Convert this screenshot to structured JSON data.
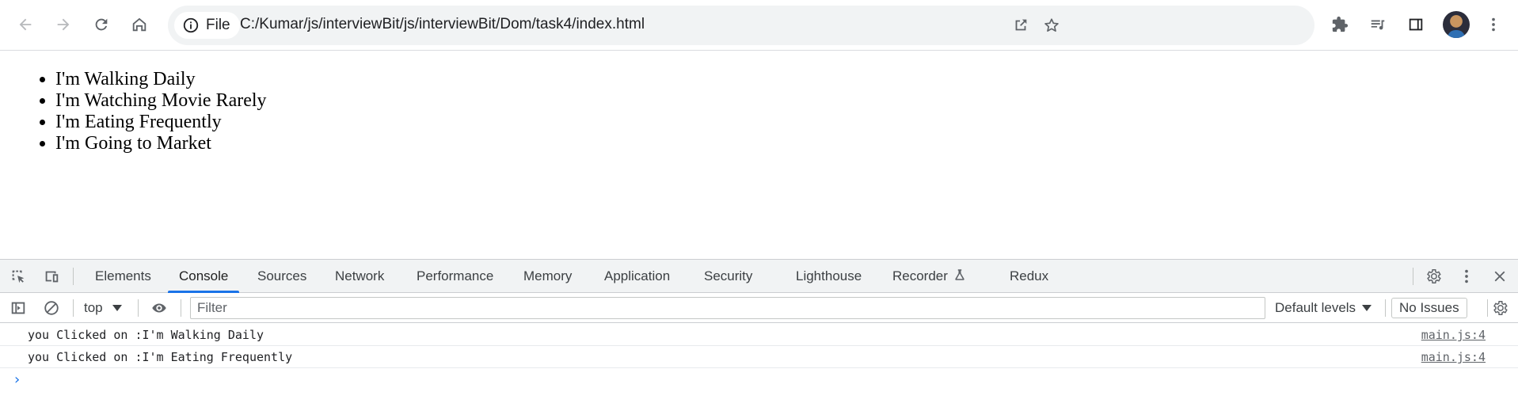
{
  "browser": {
    "site_info_label": "File",
    "url": "C:/Kumar/js/interviewBit/js/interviewBit/Dom/task4/index.html"
  },
  "page": {
    "list_items": [
      "I'm Walking Daily",
      "I'm Watching Movie Rarely",
      "I'm Eating Frequently",
      "I'm Going to Market"
    ]
  },
  "devtools": {
    "tabs": [
      "Elements",
      "Console",
      "Sources",
      "Network",
      "Performance",
      "Memory",
      "Application",
      "Security",
      "Lighthouse",
      "Recorder",
      "Redux"
    ],
    "active_tab": "Console",
    "context": "top",
    "filter_placeholder": "Filter",
    "levels_label": "Default levels",
    "issues_label": "No Issues",
    "logs": [
      {
        "message": "you Clicked on :I'm Walking Daily",
        "source": "main.js:4"
      },
      {
        "message": "you Clicked on :I'm Eating Frequently",
        "source": "main.js:4"
      }
    ],
    "prompt_symbol": "›"
  },
  "colors": {
    "accent": "#1a73e8",
    "toolbar_bg": "#f1f3f4",
    "icon": "#5f6368"
  },
  "icons": {
    "back": "arrow-left-icon",
    "forward": "arrow-right-icon",
    "reload": "reload-icon",
    "home": "home-icon",
    "site_info": "info-icon",
    "share": "share-icon",
    "bookmark": "star-icon",
    "extensions": "puzzle-icon",
    "reading_list": "playlist-icon",
    "side_panel": "side-panel-icon",
    "menu": "kebab-menu-icon"
  }
}
